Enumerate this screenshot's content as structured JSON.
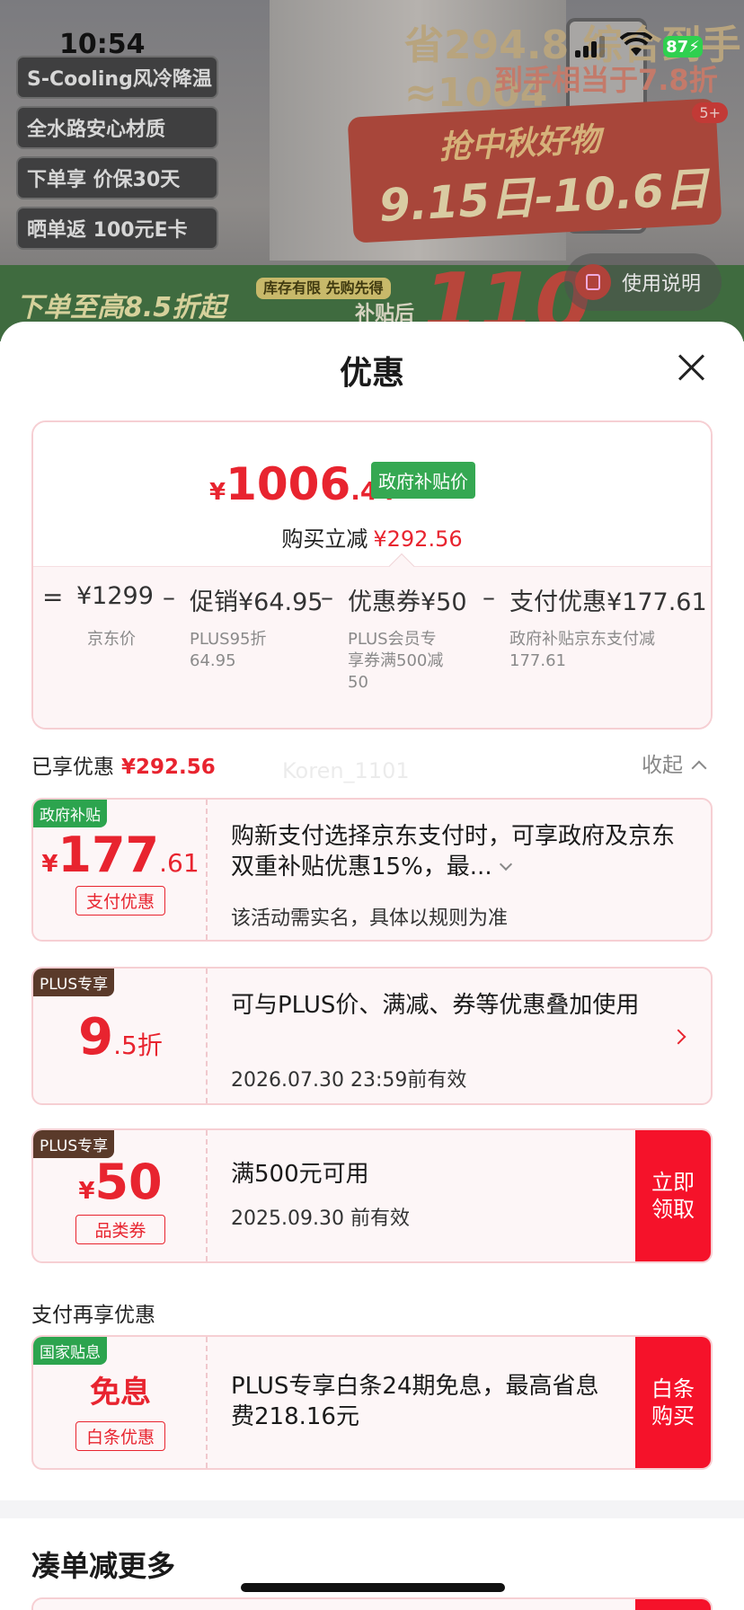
{
  "background": {
    "tags": [
      "S-Cooling风冷降温",
      "全水路安心材质",
      "下单享 价保30天",
      "晒单返 100元E卡"
    ],
    "promo_line1": "省294.8 综合到手≈1004",
    "promo_line2": "到手相当于7.8折",
    "promo_event": "抢中秋好物",
    "promo_dates": "9.15日-10.6日",
    "badge": "5+",
    "strip_text": "下单至高8.5折起",
    "strip_tag": "库存有限 先购先得",
    "strip_after": "补贴后",
    "strip_big": "110",
    "usage_label": "使用说明"
  },
  "status_bar": {
    "time": "10:54",
    "battery": "87"
  },
  "sheet": {
    "title": "优惠",
    "price": {
      "currency": "¥",
      "integer": "1006",
      "decimal": ".44",
      "tag": "政府补贴价",
      "instant_label": "购买立减",
      "instant_amount": "¥292.56"
    },
    "breakdown": {
      "equals": "=",
      "minus": "–",
      "items": [
        {
          "value": "¥1299",
          "label": "京东价"
        },
        {
          "value": "促销¥64.95",
          "label": "PLUS95折\n64.95"
        },
        {
          "value": "优惠券¥50",
          "label": "PLUS会员专\n享券满500减\n50"
        },
        {
          "value": "支付优惠¥177.61",
          "label": "政府补贴京东支付减\n177.61"
        }
      ]
    },
    "enjoyed_label": "已享优惠",
    "enjoyed_amount": "¥292.56",
    "collapse_label": "收起",
    "watermark": "Koren_1101",
    "coupons": [
      {
        "badge": "政府补贴",
        "currency": "¥",
        "amount_int": "177",
        "amount_dec": ".61",
        "type_label": "支付优惠",
        "desc": "购新支付选择京东支付时，可享政府及京东双重补贴优惠15%，最...",
        "sub": "该活动需实名，具体以规则为准"
      },
      {
        "badge": "PLUS专享",
        "amount_int": "9",
        "amount_dec": ".5折",
        "desc": "可与PLUS价、满减、券等优惠叠加使用",
        "sub": "2026.07.30 23:59前有效"
      },
      {
        "badge": "PLUS专享",
        "currency": "¥",
        "amount_int": "50",
        "type_label": "品类券",
        "desc": "满500元可用",
        "sub": "2025.09.30 前有效",
        "button": "立即领取"
      }
    ],
    "pay_more_label": "支付再享优惠",
    "pay_coupon": {
      "badge": "国家贴息",
      "amount": "免息",
      "type_label": "白条优惠",
      "desc": "PLUS专享白条24期免息，最高省息费218.16元",
      "button": "白条购买"
    },
    "more_title": "凑单减更多"
  },
  "colors": {
    "accent_red": "#e8242f",
    "button_red": "#f5122a",
    "gov_green": "#2ca44e",
    "plus_brown": "#5a3a2a"
  }
}
